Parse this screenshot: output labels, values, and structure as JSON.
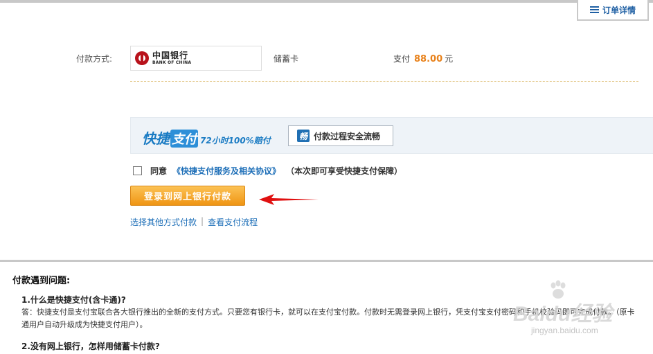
{
  "header": {
    "order_detail_label": "订单详情",
    "order_detail_icon": "list-icon"
  },
  "payment": {
    "method_label": "付款方式:",
    "bank_name_cn": "中国银行",
    "bank_name_en": "BANK OF CHINA",
    "card_type": "储蓄卡",
    "pay_prefix": "支付",
    "amount": "88.00",
    "currency": "元"
  },
  "banner": {
    "slogan_part1": "快捷",
    "slogan_part2": "支付",
    "slogan_part3": "72小时100%赔付",
    "safe_icon_glyph": "畅",
    "safe_text": "付款过程安全流畅"
  },
  "agreement": {
    "agree_label": "同意",
    "link_text": "《快捷支付服务及相关协议》",
    "note": "（本次即可享受快捷支付保障）"
  },
  "actions": {
    "main_button_label": "登录到网上银行付款",
    "other_method_link": "选择其他方式付款",
    "separator": "|",
    "view_flow_link": "查看支付流程"
  },
  "help": {
    "title": "付款遇到问题:",
    "q1": "1.什么是快捷支付(含卡通)?",
    "a1": "答：快捷支付是支付宝联合各大银行推出的全新的支付方式。只要您有银行卡，就可以在支付宝付款。付款时无需登录网上银行，凭支付宝支付密码和手机校验码即可完成付款。（原卡通用户自动升级成为快捷支付用户）。",
    "q2": "2.没有网上银行，怎样用储蓄卡付款?"
  },
  "watermark": {
    "brand": "Baidu经验",
    "url": "jingyan.baidu.com"
  },
  "colors": {
    "accent_blue": "#1e6fb8",
    "amount_orange": "#e8811a",
    "button_orange": "#ef9514",
    "arrow_red": "#e01010"
  }
}
